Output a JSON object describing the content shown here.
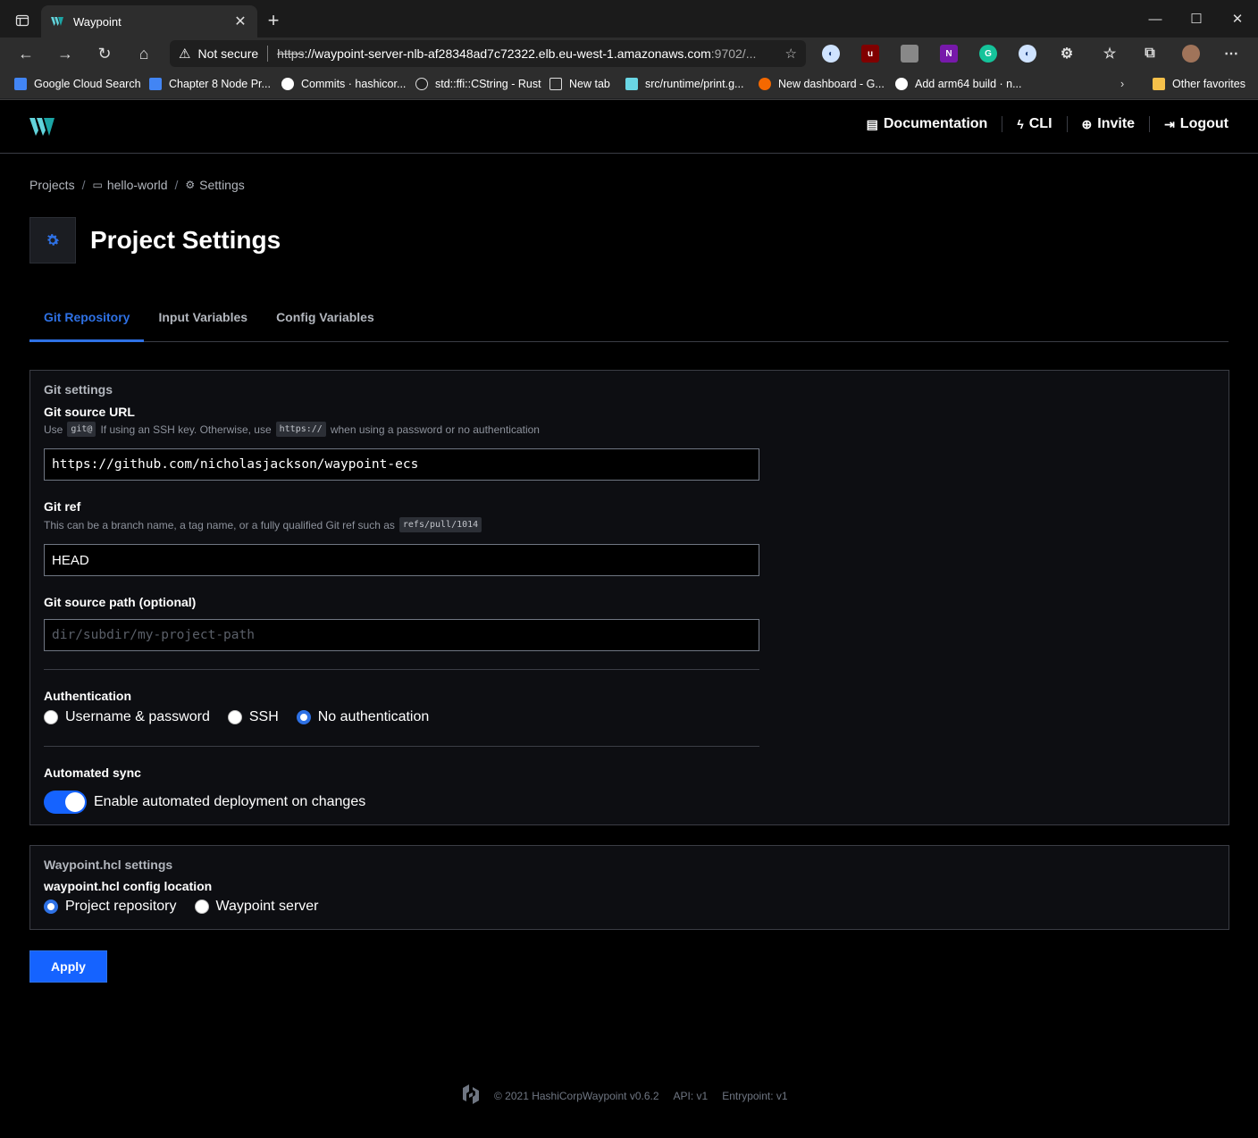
{
  "browser": {
    "tab_title": "Waypoint",
    "security_label": "Not secure",
    "url_protocol": "https",
    "url_host": "://waypoint-server-nlb-af28348ad7c72322.elb.eu-west-1.amazonaws.com",
    "url_rest": ":9702/...",
    "bookmarks": [
      "Google Cloud Search",
      "Chapter 8 Node Pr...",
      "Commits · hashicor...",
      "std::ffi::CString - Rust",
      "New tab",
      "src/runtime/print.g...",
      "New dashboard - G...",
      "Add arm64 build · n...",
      "Other favorites"
    ]
  },
  "header": {
    "nav": [
      "Documentation",
      "CLI",
      "Invite",
      "Logout"
    ]
  },
  "breadcrumb": {
    "root": "Projects",
    "project": "hello-world",
    "current": "Settings"
  },
  "page": {
    "title": "Project Settings",
    "tabs": [
      "Git Repository",
      "Input Variables",
      "Config Variables"
    ]
  },
  "git": {
    "legend": "Git settings",
    "url_label": "Git source URL",
    "url_help_1": "Use",
    "url_help_code_1": "git@",
    "url_help_2": "If using an SSH key. Otherwise, use",
    "url_help_code_2": "https://",
    "url_help_3": "when using a password or no authentication",
    "url_value": "https://github.com/nicholasjackson/waypoint-ecs",
    "ref_label": "Git ref",
    "ref_help": "This can be a branch name, a tag name, or a fully qualified Git ref such as",
    "ref_help_code": "refs/pull/1014",
    "ref_value": "HEAD",
    "path_label": "Git source path (optional)",
    "path_placeholder": "dir/subdir/my-project-path",
    "auth_label": "Authentication",
    "auth_options": [
      "Username & password",
      "SSH",
      "No authentication"
    ],
    "auth_selected": "No authentication",
    "sync_label": "Automated sync",
    "sync_toggle_label": "Enable automated deployment on changes",
    "sync_enabled": true
  },
  "hcl": {
    "legend": "Waypoint.hcl settings",
    "location_label": "waypoint.hcl config location",
    "options": [
      "Project repository",
      "Waypoint server"
    ],
    "selected": "Project repository"
  },
  "apply_label": "Apply",
  "footer": {
    "copyright": "© 2021 HashiCorp",
    "version": "Waypoint v0.6.2",
    "api": "API: v1",
    "entrypoint": "Entrypoint: v1"
  },
  "colors": {
    "accent": "#1563ff",
    "tab_active": "#2e71e5",
    "panel_bg": "#0d0e12",
    "page_bg": "#000000"
  }
}
